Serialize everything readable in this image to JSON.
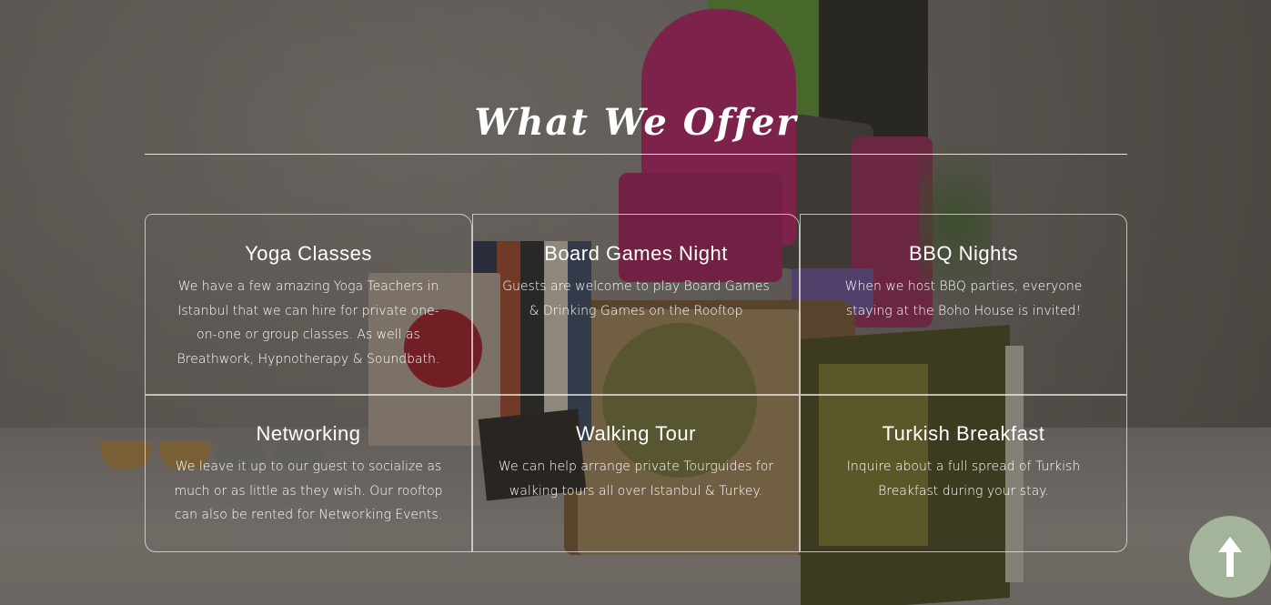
{
  "section": {
    "title": "What We Offer"
  },
  "offers": [
    {
      "title": "Yoga Classes",
      "description": "We have a few amazing Yoga Teachers in Istanbul that we can hire for private one-on-one or group classes. As well as Breathwork, Hypnotherapy & Soundbath."
    },
    {
      "title": "Board Games Night",
      "description": "Guests are welcome to play Board Games & Drinking Games on the Rooftop"
    },
    {
      "title": "BBQ Nights",
      "description": "When we host BBQ parties, everyone staying at the Boho House is invited!"
    },
    {
      "title": "Networking",
      "description": "We leave it up to our guest to socialize as much or as little as they wish. Our rooftop can also be rented for Networking Events."
    },
    {
      "title": "Walking Tour",
      "description": "We can help arrange private Tourguides for walking tours all over Istanbul & Turkey."
    },
    {
      "title": "Turkish Breakfast",
      "description": "Inquire about a full spread of Turkish Breakfast during your stay."
    }
  ],
  "back_to_top": {
    "icon": "arrow-up-icon",
    "color": "#a3b49a"
  }
}
